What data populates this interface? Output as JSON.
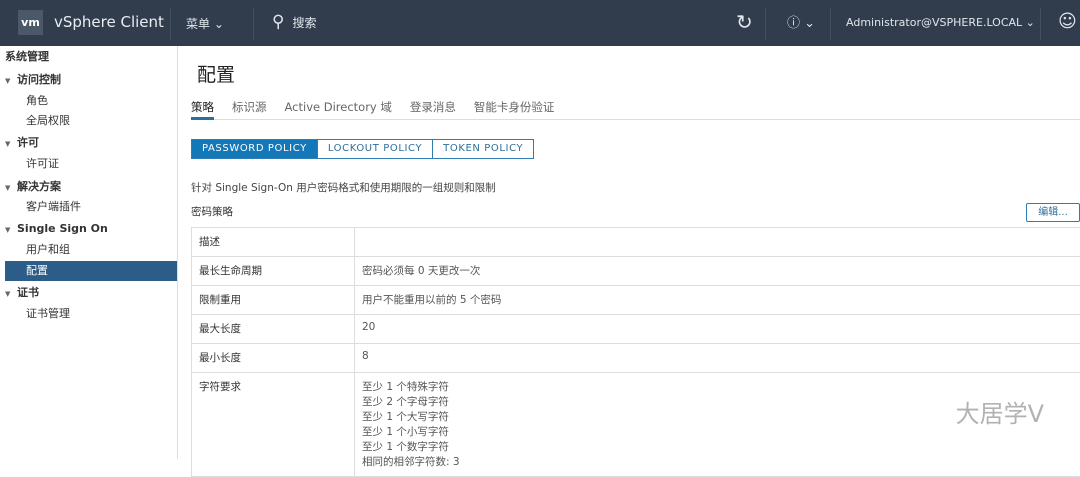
{
  "header": {
    "logo": "vm",
    "app_name": "vSphere Client",
    "menu_label": "菜单",
    "search_placeholder": "搜索",
    "user": "Administrator@VSPHERE.LOCAL"
  },
  "sidebar": {
    "items": [
      {
        "label": "系统管理"
      },
      {
        "label": "访问控制"
      },
      {
        "label": "角色"
      },
      {
        "label": "全局权限"
      },
      {
        "label": "许可"
      },
      {
        "label": "许可证"
      },
      {
        "label": "解决方案"
      },
      {
        "label": "客户端插件"
      },
      {
        "label": "Single Sign On"
      },
      {
        "label": "用户和组"
      },
      {
        "label": "配置"
      },
      {
        "label": "证书"
      },
      {
        "label": "证书管理"
      }
    ]
  },
  "main": {
    "title": "配置",
    "tabs": [
      {
        "label": "策略"
      },
      {
        "label": "标识源"
      },
      {
        "label": "Active Directory 域"
      },
      {
        "label": "登录消息"
      },
      {
        "label": "智能卡身份验证"
      }
    ],
    "policy_buttons": [
      {
        "label": "PASSWORD POLICY"
      },
      {
        "label": "LOCKOUT POLICY"
      },
      {
        "label": "TOKEN POLICY"
      }
    ],
    "description": "针对 Single Sign-On 用户密码格式和使用期限的一组规则和限制",
    "section_title": "密码策略",
    "edit_label": "编辑...",
    "rows": [
      {
        "key": "描述",
        "value": ""
      },
      {
        "key": "最长生命周期",
        "value": "密码必须每 0 天更改一次"
      },
      {
        "key": "限制重用",
        "value": "用户不能重用以前的 5 个密码"
      },
      {
        "key": "最大长度",
        "value": "20"
      },
      {
        "key": "最小长度",
        "value": "8"
      },
      {
        "key": "字符要求",
        "lines": [
          "至少 1 个特殊字符",
          "至少 2 个字母字符",
          "至少 1 个大写字符",
          "至少 1 个小写字符",
          "至少 1 个数字字符",
          "相同的相邻字符数: 3"
        ]
      }
    ]
  },
  "watermark": "大居学V"
}
